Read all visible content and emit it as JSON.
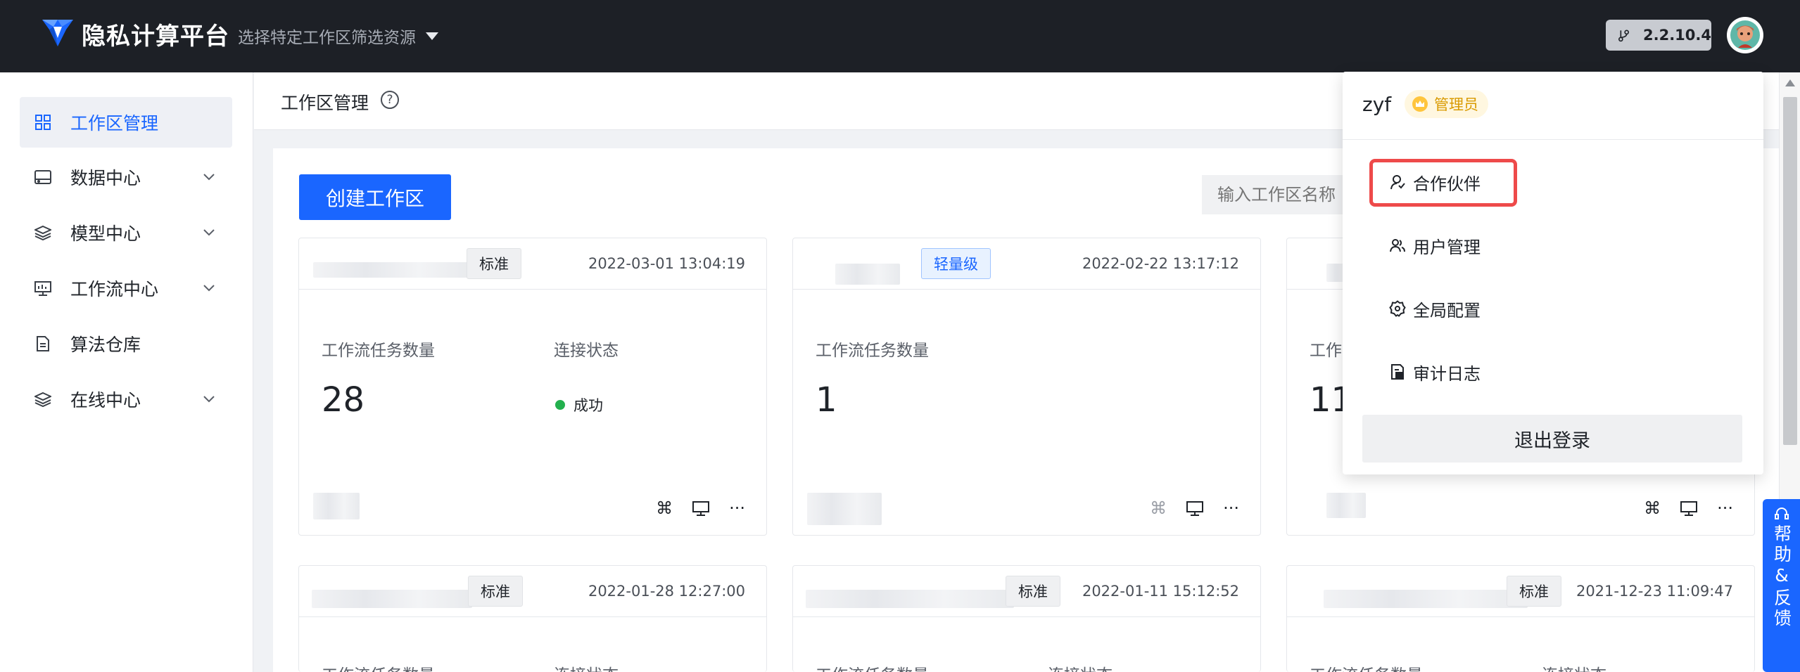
{
  "header": {
    "brand": "隐私计算平台",
    "workspace_filter": "选择特定工作区筛选资源",
    "version": "2.2.10.4",
    "brand_color": "#1a66ff"
  },
  "sidebar": {
    "items": [
      {
        "label": "工作区管理",
        "icon": "grid-icon",
        "active": true
      },
      {
        "label": "数据中心",
        "icon": "drive-icon",
        "expandable": true
      },
      {
        "label": "模型中心",
        "icon": "layers-icon",
        "expandable": true
      },
      {
        "label": "工作流中心",
        "icon": "monitor-icon",
        "expandable": true
      },
      {
        "label": "算法仓库",
        "icon": "document-icon"
      },
      {
        "label": "在线中心",
        "icon": "layers-icon",
        "expandable": true
      }
    ]
  },
  "page": {
    "title": "工作区管理",
    "create_button": "创建工作区",
    "search_placeholder": "输入工作区名称"
  },
  "cards": [
    {
      "tag": "标准",
      "date": "2022-03-01 13:04:19",
      "tasks_label": "工作流任务数量",
      "tasks": "28",
      "conn_label": "连接状态",
      "conn_status": "成功"
    },
    {
      "tag": "轻量级",
      "date": "2022-02-22 13:17:12",
      "tasks_label": "工作流任务数量",
      "tasks": "1"
    },
    {
      "tasks_label": "工作",
      "tasks": "11"
    },
    {
      "tag": "标准",
      "date": "2022-01-28 12:27:00",
      "tasks_label": "工作流任务数量",
      "conn_label": "连接状态"
    },
    {
      "tag": "标准",
      "date": "2022-01-11 15:12:52",
      "tasks_label": "工作流任务数量",
      "conn_label": "连接状态"
    },
    {
      "tag": "标准",
      "date": "2021-12-23 11:09:47",
      "tasks_label": "工作流任务数量",
      "conn_label": "连接状态"
    }
  ],
  "user_menu": {
    "username": "zyf",
    "role": "管理员",
    "items": [
      {
        "label": "合作伙伴",
        "icon": "partner-icon",
        "highlighted": true
      },
      {
        "label": "用户管理",
        "icon": "users-icon"
      },
      {
        "label": "全局配置",
        "icon": "gear-icon"
      },
      {
        "label": "审计日志",
        "icon": "audit-log-icon"
      }
    ],
    "logout": "退出登录"
  },
  "feedback": {
    "label": "帮助&反馈"
  }
}
